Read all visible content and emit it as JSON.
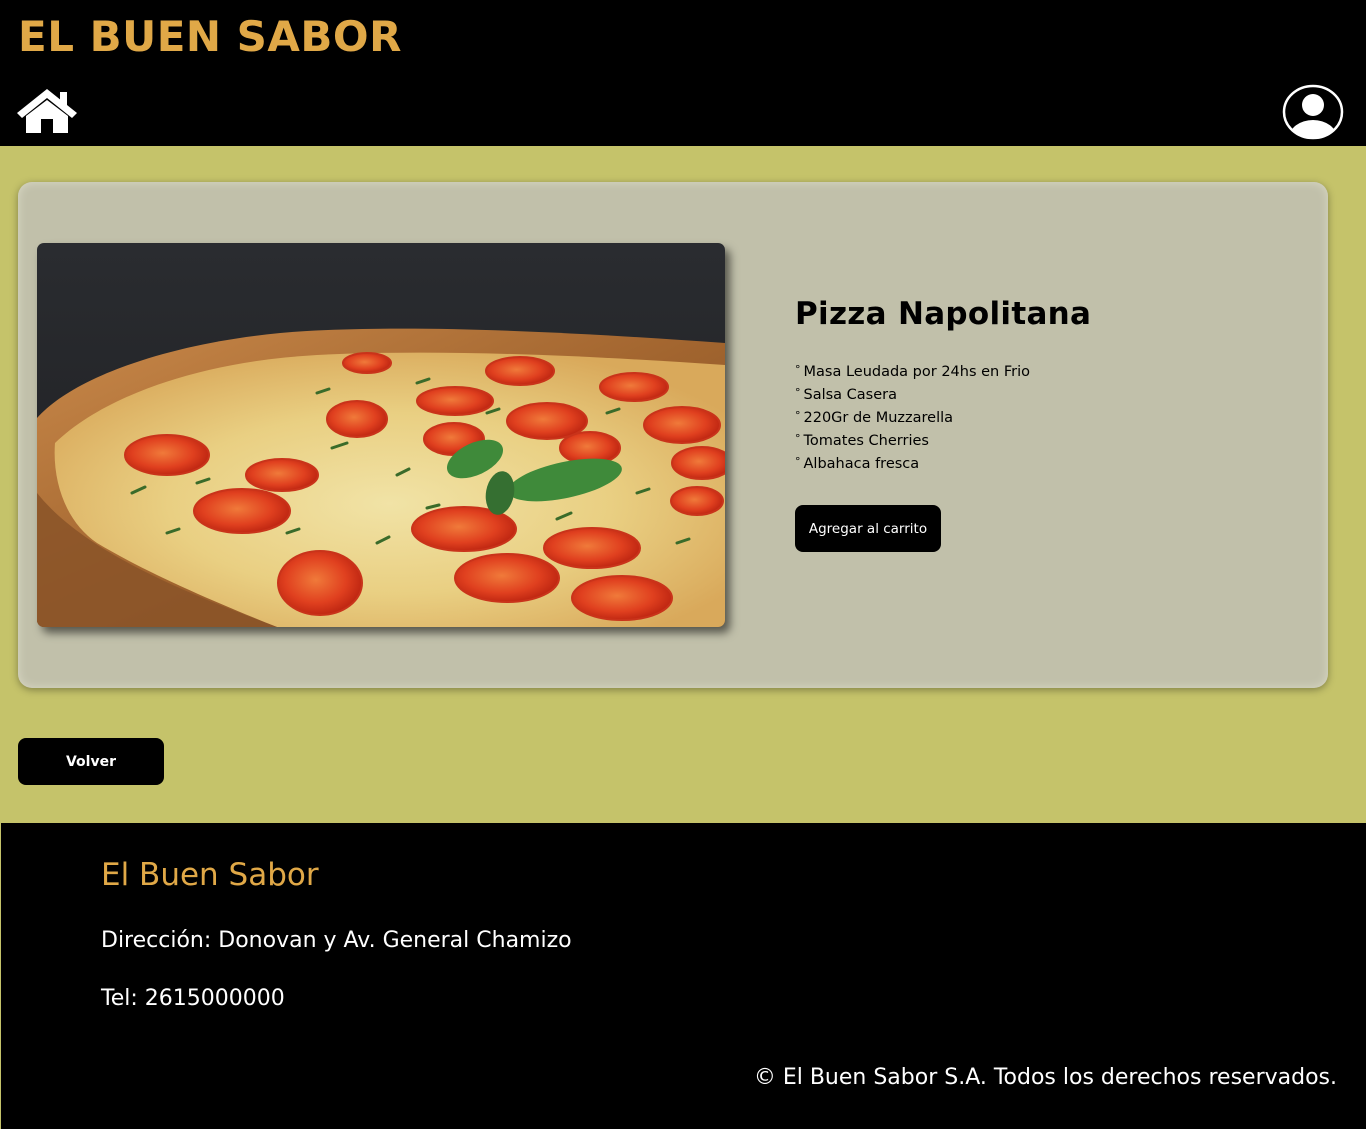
{
  "header": {
    "brand": "EL BUEN SABOR",
    "home_icon": "home-icon",
    "user_icon": "user-avatar-icon"
  },
  "product": {
    "title": "Pizza Napolitana",
    "image_subject": "pizza",
    "ingredients": [
      "Masa Leudada por 24hs en Frio",
      "Salsa Casera",
      "220Gr de Muzzarella",
      "Tomates Cherries",
      "Albahaca fresca"
    ],
    "add_to_cart_label": "Agregar al carrito"
  },
  "navigation": {
    "back_label": "Volver"
  },
  "footer": {
    "brand": "El Buen Sabor",
    "address": "Dirección: Donovan y Av. General Chamizo",
    "phone": "Tel: 2615000000",
    "copyright": "© El Buen Sabor S.A. Todos los derechos reservados."
  },
  "colors": {
    "accent_gold": "#e0a847",
    "page_background": "#c5c36a",
    "card_background": "#c1c0aa",
    "header_footer": "#000000"
  }
}
